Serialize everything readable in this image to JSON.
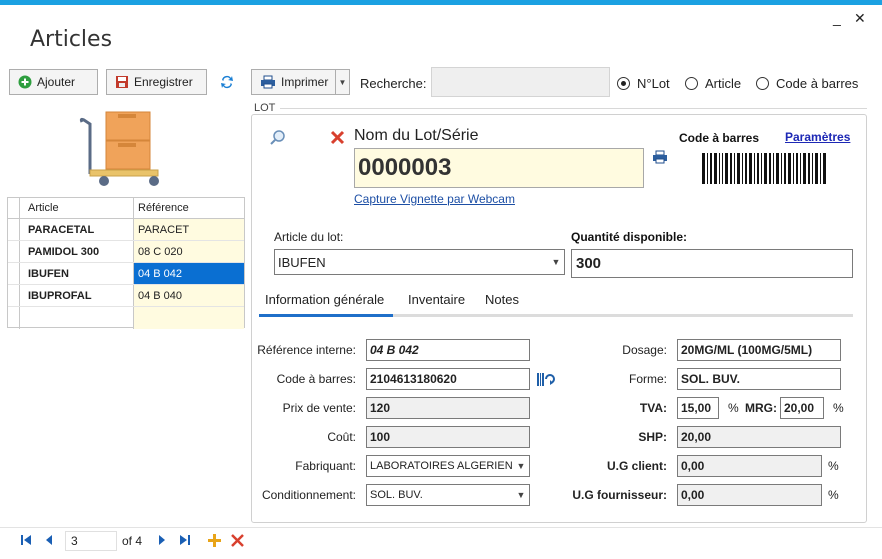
{
  "window": {
    "title": "Articles",
    "minimize": "_",
    "close": "✕"
  },
  "toolbar": {
    "add_label": "Ajouter",
    "save_label": "Enregistrer",
    "print_label": "Imprimer",
    "search_label": "Recherche:",
    "search_value": ""
  },
  "search_modes": [
    {
      "label": "N°Lot",
      "selected": true
    },
    {
      "label": "Article",
      "selected": false
    },
    {
      "label": "Code à barres",
      "selected": false
    }
  ],
  "grid": {
    "columns": [
      "Article",
      "Référence"
    ],
    "rows": [
      {
        "article": "PARACETAL",
        "reference": "PARACET",
        "selected": false
      },
      {
        "article": "PAMIDOL 300",
        "reference": "08 C 020",
        "selected": false
      },
      {
        "article": "IBUFEN",
        "reference": "04 B 042",
        "selected": true
      },
      {
        "article": "IBUPROFAL",
        "reference": "04 B 040",
        "selected": false
      }
    ]
  },
  "lot": {
    "group_label": "LOT",
    "name_label": "Nom du Lot/Série",
    "lot_number": "0000003",
    "webcam_link": "Capture Vignette par Webcam",
    "barcode_label": "Code à barres",
    "settings_link": "Paramètres",
    "article_label": "Article du lot:",
    "article_value": "IBUFEN",
    "qty_label": "Quantité disponible:",
    "qty_value": "300"
  },
  "tabs": [
    "Information générale",
    "Inventaire",
    "Notes"
  ],
  "form": {
    "ref_label": "Référence interne:",
    "ref_value": "04 B 042",
    "barcode_label": "Code à barres:",
    "barcode_value": "2104613180620",
    "price_label": "Prix de vente:",
    "price_value": "120",
    "cost_label": "Coût:",
    "cost_value": "100",
    "maker_label": "Fabriquant:",
    "maker_value": "LABORATOIRES ALGERIEN",
    "pack_label": "Conditionnement:",
    "pack_value": "SOL. BUV.",
    "dosage_label": "Dosage:",
    "dosage_value": "20MG/ML (100MG/5ML)",
    "form_label": "Forme:",
    "form_value": "SOL. BUV.",
    "tva_label": "TVA:",
    "tva_value": "15,00",
    "pct1": "%",
    "mrg_label": "MRG:",
    "mrg_value": "20,00",
    "pct2": "%",
    "shp_label": "SHP:",
    "shp_value": "20,00",
    "ugc_label": "U.G client:",
    "ugc_value": "0,00",
    "pct3": "%",
    "ugf_label": "U.G fournisseur:",
    "ugf_value": "0,00",
    "pct4": "%"
  },
  "navigator": {
    "position": "3",
    "of_label": "of 4"
  }
}
